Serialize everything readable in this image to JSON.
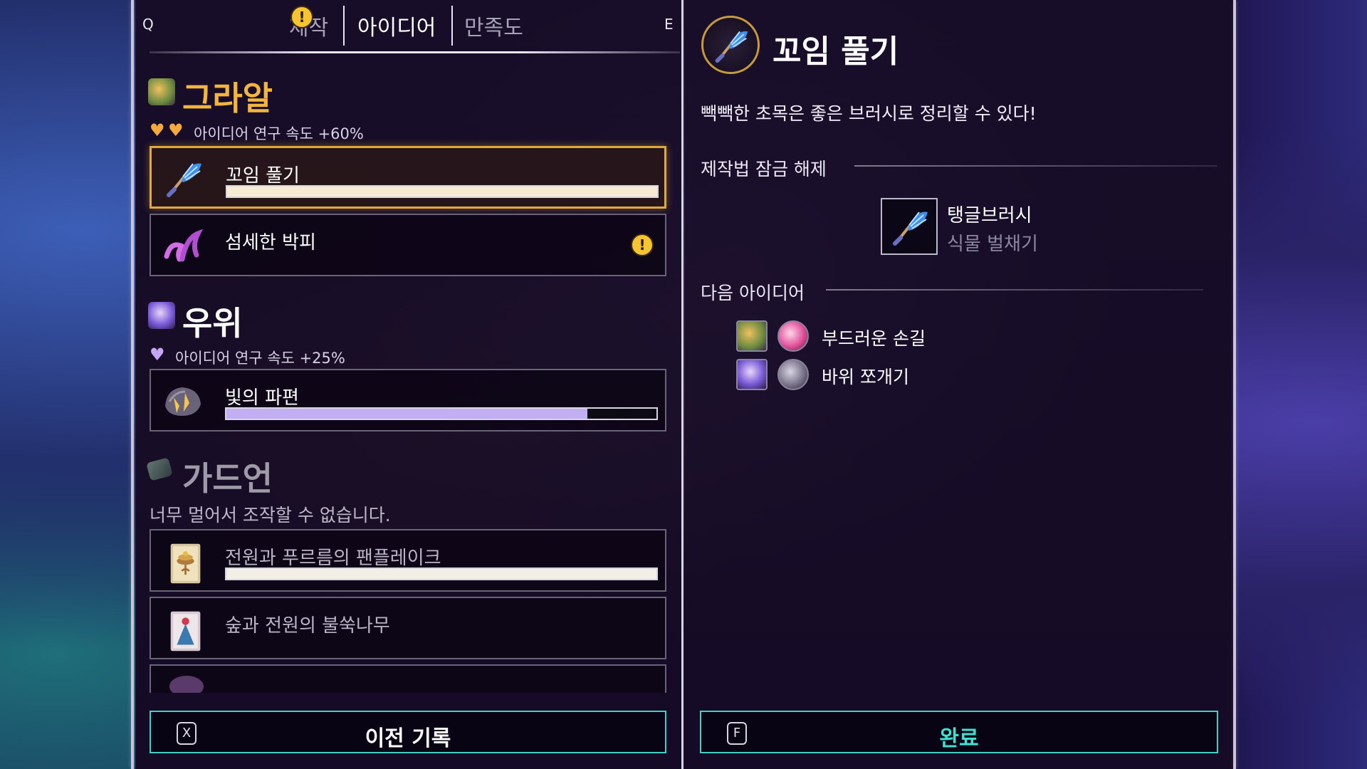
{
  "tabs": {
    "key_left": "Q",
    "key_right": "E",
    "items": [
      {
        "label": "제작"
      },
      {
        "label": "아이디어"
      },
      {
        "label": "만족도"
      }
    ],
    "alert_mark": "!"
  },
  "groups": [
    {
      "title": "그라알",
      "subtitle": "아이디어 연구 속도 +60%",
      "title_color": "#f3b53c",
      "hearts": 2,
      "heart_color": "#f3a93c",
      "items": [
        {
          "name": "꼬임 풀기",
          "progress": 1.0,
          "bar_color": "#f7ecd2",
          "selected": true,
          "icon": "brush-icon"
        },
        {
          "name": "섬세한 박피",
          "alert": "!",
          "icon": "tentacle-icon"
        }
      ]
    },
    {
      "title": "우위",
      "subtitle": "아이디어 연구 속도 +25%",
      "title_color": "#ffffff",
      "hearts": 1,
      "heart_color": "#c4a6f2",
      "items": [
        {
          "name": "빛의 파편",
          "progress": 0.84,
          "bar_color": "#c2aef2",
          "icon": "crystal-rock-icon"
        }
      ]
    },
    {
      "title": "가드언",
      "subtitle": "너무 멀어서 조작할 수 없습니다.",
      "title_color": "#9f9aa8",
      "items": [
        {
          "name": "전원과 푸르름의 팬플레이크",
          "progress": 1.0,
          "bar_color": "#f3efe6",
          "icon": "pancake-card-icon"
        },
        {
          "name": "숲과 전원의 불쑥나무",
          "icon": "tree-card-icon"
        }
      ]
    }
  ],
  "buttons": {
    "history": {
      "key": "X",
      "label": "이전 기록"
    },
    "done": {
      "key": "F",
      "label": "완료",
      "color": "#3fe0d2"
    }
  },
  "detail": {
    "title": "꼬임 풀기",
    "description": "빽빽한 초목은 좋은 브러시로 정리할 수 있다!",
    "unlock_heading": "제작법 잠금 해제",
    "recipe": {
      "name": "탱글브러시",
      "category": "식물 벌채기"
    },
    "next_heading": "다음 아이디어",
    "next_ideas": [
      {
        "label": "부드러운 손길",
        "portrait": "grawl-portrait-icon",
        "orb": "pink-orb-icon"
      },
      {
        "label": "바위 쪼개기",
        "portrait": "uwi-portrait-icon",
        "orb": "rock-orb-icon"
      }
    ]
  }
}
